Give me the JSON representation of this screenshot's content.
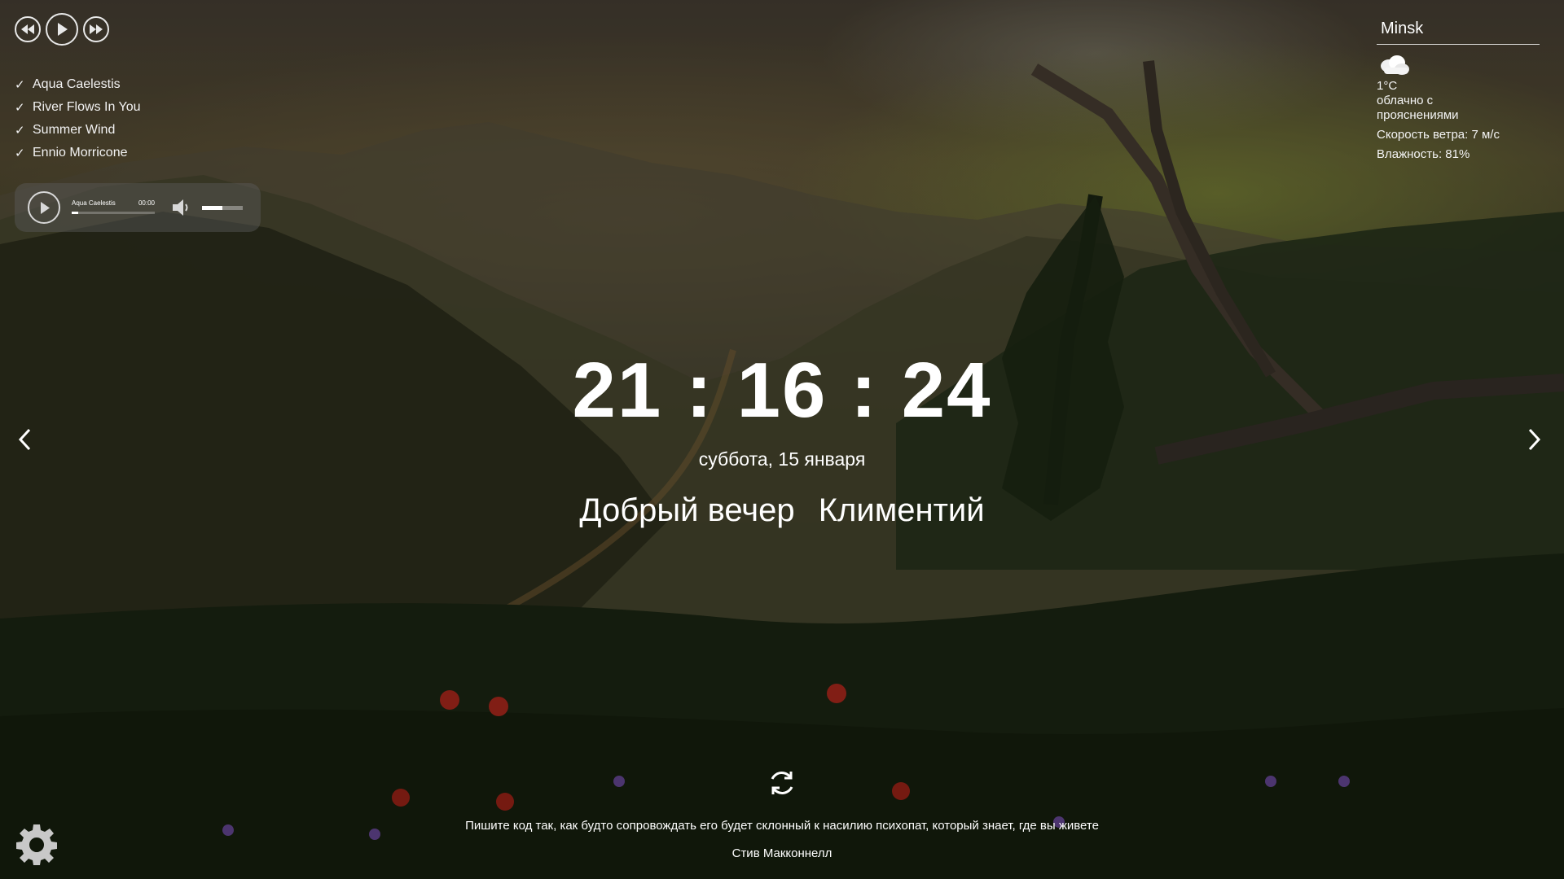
{
  "player_controls": {
    "prev_icon": "rewind-icon",
    "play_icon": "play-icon",
    "next_icon": "fast-forward-icon"
  },
  "playlist": [
    {
      "label": "Aqua Caelestis",
      "check": "✓"
    },
    {
      "label": "River Flows In You",
      "check": "✓"
    },
    {
      "label": "Summer Wind",
      "check": "✓"
    },
    {
      "label": "Ennio Morricone",
      "check": "✓"
    }
  ],
  "audio_player": {
    "track": "Aqua Caelestis",
    "time": "00:00",
    "progress": 0.08,
    "volume": 0.5
  },
  "weather": {
    "city": "Minsk",
    "icon": "cloudy-icon",
    "temperature": "1°C",
    "description_1": "облачно с",
    "description_2": "прояснениями",
    "wind": "Скорость ветра: 7 м/с",
    "humidity": "Влажность: 81%"
  },
  "clock": {
    "time": "21 : 16 : 24",
    "date": "суббота, 15 января"
  },
  "greeting": {
    "text": "Добрый вечер",
    "name": "Климентий"
  },
  "quote": {
    "text": "Пишите код так, как будто сопровождать его будет склонный к насилию психопат, который знает, где вы живете",
    "author": "Стив Макконнелл"
  },
  "colors": {
    "text": "#ffffff",
    "player_bg": "rgba(90,90,90,0.45)"
  }
}
